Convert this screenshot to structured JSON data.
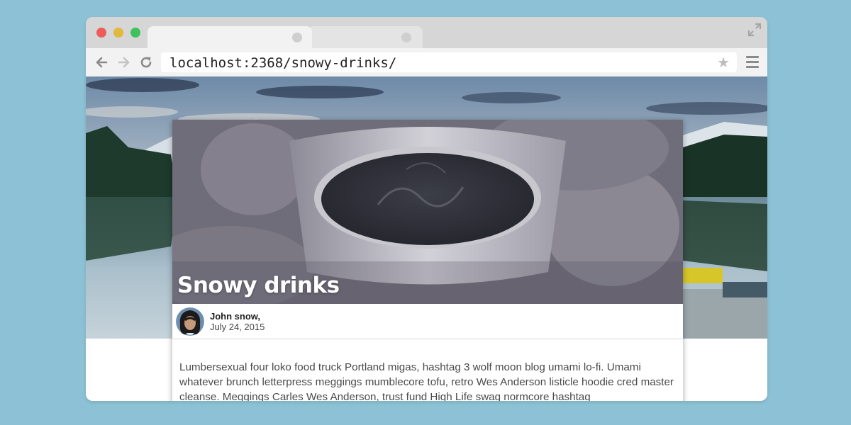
{
  "browser": {
    "url": "localhost:2368/snowy-drinks/"
  },
  "post": {
    "title": "Snowy drinks",
    "author": "John snow",
    "author_separator": ",",
    "date": "July 24, 2015",
    "body": "Lumbersexual four loko food truck Portland migas, hashtag 3 wolf moon blog umami lo-fi. Umami whatever brunch letterpress meggings mumblecore tofu, retro Wes Anderson listicle hoodie cred master cleanse. Meggings Carles Wes Anderson, trust fund High Life swag normcore hashtag"
  },
  "icons": {
    "back": "back-arrow-icon",
    "forward": "forward-arrow-icon",
    "reload": "reload-icon",
    "bookmark": "star-icon",
    "menu": "hamburger-menu-icon",
    "fullscreen": "expand-icon"
  },
  "colors": {
    "page_background": "#8dc2d6",
    "close": "#ee5b5b",
    "minimize": "#e2b93b",
    "maximize": "#3dc35c"
  }
}
